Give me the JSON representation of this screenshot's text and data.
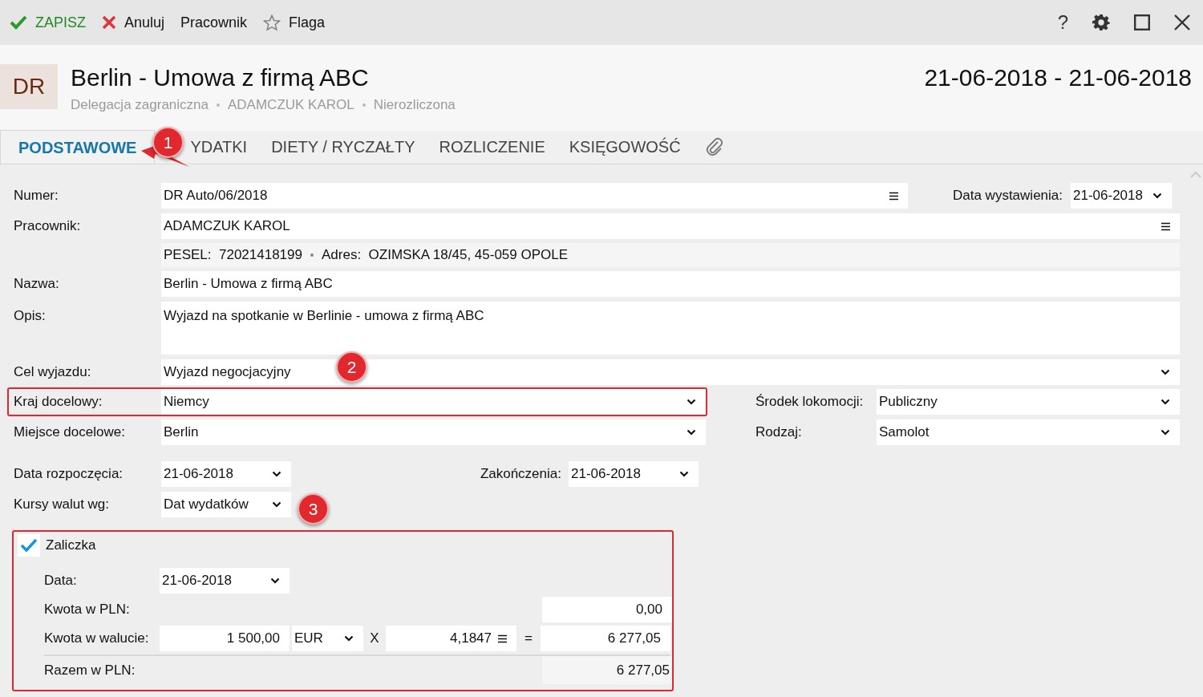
{
  "toolbar": {
    "actions": [
      {
        "kind": "save",
        "label": "ZAPISZ"
      },
      {
        "kind": "cancel",
        "label": "Anuluj"
      },
      {
        "kind": "plain",
        "label": "Pracownik"
      },
      {
        "kind": "flag",
        "label": "Flaga"
      }
    ],
    "help": "?"
  },
  "header": {
    "badge": "DR",
    "title": "Berlin - Umowa z firmą ABC",
    "meta": [
      "Delegacja zagraniczna",
      "ADAMCZUK KAROL",
      "Nierozliczona"
    ],
    "date_range": "21-06-2018 - 21-06-2018"
  },
  "tabs": [
    {
      "label": "PODSTAWOWE",
      "selected": true
    },
    {
      "label": "YDATKI",
      "selected": false
    },
    {
      "label": "DIETY / RYCZAŁTY",
      "selected": false
    },
    {
      "label": "ROZLICZENIE",
      "selected": false
    },
    {
      "label": "KSIĘGOWOŚĆ",
      "selected": false
    }
  ],
  "form": {
    "numer": {
      "label": "Numer:",
      "value": "DR Auto/06/2018"
    },
    "data_wystawienia": {
      "label": "Data wystawienia:",
      "value": "21-06-2018"
    },
    "pracownik": {
      "label": "Pracownik:",
      "value": "ADAMCZUK KAROL"
    },
    "employee_info": [
      "PESEL:  72021418199",
      "Adres:  OZIMSKA 18/45, 45-059 OPOLE"
    ],
    "nazwa": {
      "label": "Nazwa:",
      "value": "Berlin - Umowa z firmą ABC"
    },
    "opis": {
      "label": "Opis:",
      "value": "Wyjazd na spotkanie w Berlinie - umowa z firmą ABC"
    },
    "cel": {
      "label": "Cel wyjazdu:",
      "value": "Wyjazd negocjacyjny"
    },
    "kraj": {
      "label": "Kraj docelowy:",
      "value": "Niemcy"
    },
    "srodek": {
      "label": "Środek lokomocji:",
      "value": "Publiczny"
    },
    "miejsce": {
      "label": "Miejsce docelowe:",
      "value": "Berlin"
    },
    "rodzaj": {
      "label": "Rodzaj:",
      "value": "Samolot"
    },
    "data_rozpoczecia": {
      "label": "Data rozpoczęcia:",
      "value": "21-06-2018"
    },
    "zakonczenia": {
      "label": "Zakończenia:",
      "value": "21-06-2018"
    },
    "kursy": {
      "label": "Kursy walut wg:",
      "value": "Dat wydatków"
    }
  },
  "advance": {
    "label": "Zaliczka",
    "checked": true,
    "data": {
      "label": "Data:",
      "value": "21-06-2018"
    },
    "kwota_pln": {
      "label": "Kwota w PLN:",
      "value": "0,00"
    },
    "kwota_waluta": {
      "label": "Kwota w walucie:",
      "amount": "1 500,00",
      "currency": "EUR",
      "times": "X",
      "rate": "4,1847",
      "equals": "=",
      "result": "6 277,05"
    },
    "razem": {
      "label": "Razem w PLN:",
      "value": "6 277,05"
    }
  },
  "annotations": {
    "markers": [
      "1",
      "2",
      "3"
    ]
  }
}
